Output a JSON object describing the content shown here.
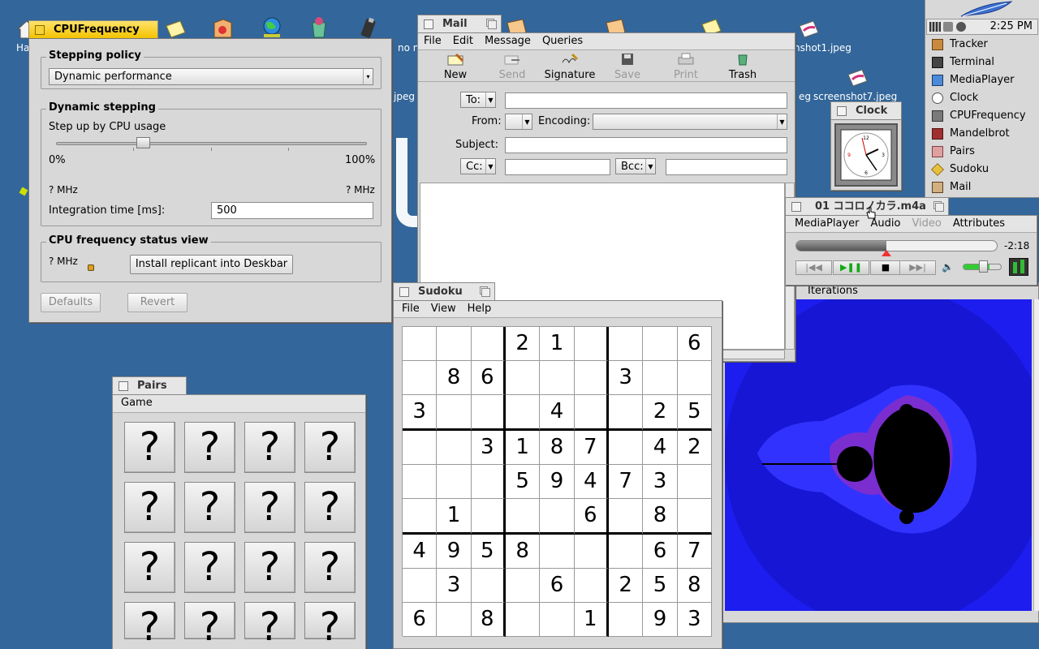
{
  "desktop": {
    "icons": [
      {
        "label": "Ha",
        "name": "home-icon"
      },
      {
        "label": "no n",
        "name": "document-icon"
      },
      {
        "label": "nshot1.jpeg",
        "name": "image-file-icon"
      },
      {
        "label": "jpeg",
        "name": "image-file-icon"
      },
      {
        "label": "screenshot7.jpeg",
        "name": "image-file-icon"
      },
      {
        "label": "eg",
        "name": "image-file-icon"
      }
    ]
  },
  "cpu": {
    "title": "CPUFrequency",
    "policy_title": "Stepping policy",
    "policy_value": "Dynamic performance",
    "dyn_title": "Dynamic stepping",
    "step_label": "Step up by CPU usage",
    "slider_min": "0%",
    "slider_max": "100%",
    "slider_value": 0.28,
    "mhz_left": "? MHz",
    "mhz_right": "? MHz",
    "integration_label": "Integration time [ms]:",
    "integration_value": "500",
    "status_title": "CPU frequency status view",
    "status_mhz": "? MHz",
    "install_button": "Install replicant into Deskbar",
    "defaults_button": "Defaults",
    "revert_button": "Revert"
  },
  "mail": {
    "title": "Mail",
    "menu": [
      "File",
      "Edit",
      "Message",
      "Queries"
    ],
    "toolbar": [
      {
        "label": "New",
        "enabled": true,
        "icon": "new-mail-icon"
      },
      {
        "label": "Send",
        "enabled": false,
        "icon": "send-icon"
      },
      {
        "label": "Signature",
        "enabled": true,
        "icon": "signature-icon"
      },
      {
        "label": "Save",
        "enabled": false,
        "icon": "save-icon"
      },
      {
        "label": "Print",
        "enabled": false,
        "icon": "print-icon"
      },
      {
        "label": "Trash",
        "enabled": true,
        "icon": "trash-icon"
      }
    ],
    "to_label": "To:",
    "from_label": "From:",
    "encoding_label": "Encoding:",
    "subject_label": "Subject:",
    "cc_label": "Cc:",
    "bcc_label": "Bcc:",
    "to_value": "",
    "subject_value": "",
    "cc_value": "",
    "bcc_value": ""
  },
  "clock": {
    "title": "Clock"
  },
  "media": {
    "title": "01 ココロノカラ.m4a",
    "menu": [
      "MediaPlayer",
      "Audio",
      "Video",
      "Attributes"
    ],
    "time": "-2:18",
    "position": 0.45,
    "volume": 0.7
  },
  "mandelbrot": {
    "label": "Iterations"
  },
  "sudoku": {
    "title": "Sudoku",
    "menu": [
      "File",
      "View",
      "Help"
    ],
    "grid": [
      [
        "",
        "",
        "",
        "2",
        "1",
        "",
        "",
        "",
        "6"
      ],
      [
        "",
        "8",
        "6",
        "",
        "",
        "",
        "3",
        "",
        ""
      ],
      [
        "3",
        "",
        "",
        "",
        "4",
        "",
        "",
        "2",
        "5"
      ],
      [
        "",
        "",
        "3",
        "1",
        "8",
        "7",
        "",
        "4",
        "2"
      ],
      [
        "",
        "",
        "",
        "5",
        "9",
        "4",
        "7",
        "3",
        ""
      ],
      [
        "",
        "1",
        "",
        "",
        "",
        "6",
        "",
        "8",
        ""
      ],
      [
        "4",
        "9",
        "5",
        "8",
        "",
        "",
        "",
        "6",
        "7"
      ],
      [
        "",
        "3",
        "",
        "",
        "6",
        "",
        "2",
        "5",
        "8"
      ],
      [
        "6",
        "",
        "8",
        "",
        "",
        "1",
        "",
        "9",
        "3"
      ]
    ]
  },
  "pairs": {
    "title": "Pairs",
    "menu": "Game",
    "card": "?"
  },
  "deskbar": {
    "time": "2:25 PM",
    "items": [
      {
        "label": "Tracker",
        "icon": "tracker-icon"
      },
      {
        "label": "Terminal",
        "icon": "terminal-icon"
      },
      {
        "label": "MediaPlayer",
        "icon": "mediaplayer-icon"
      },
      {
        "label": "Clock",
        "icon": "clock-icon"
      },
      {
        "label": "CPUFrequency",
        "icon": "cpu-icon"
      },
      {
        "label": "Mandelbrot",
        "icon": "mandelbrot-icon"
      },
      {
        "label": "Pairs",
        "icon": "pairs-icon"
      },
      {
        "label": "Sudoku",
        "icon": "sudoku-icon"
      },
      {
        "label": "Mail",
        "icon": "mail-icon"
      }
    ]
  }
}
